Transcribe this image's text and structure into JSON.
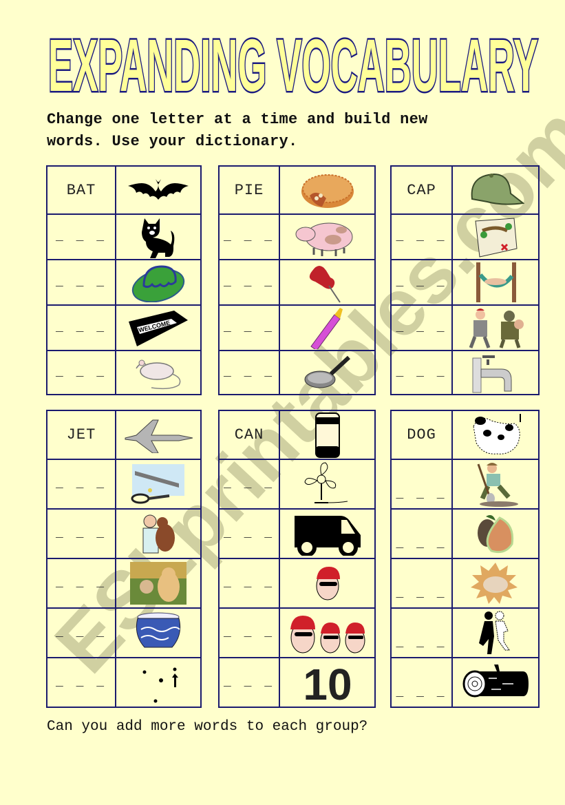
{
  "title": "EXPANDING VOCABULARY",
  "instructions": [
    "Change one letter at a time and build new",
    "words. Use your dictionary."
  ],
  "footer": "Can you add more words to each group?",
  "watermark": "ESLprintables.com",
  "blank": "_ _ _",
  "colors": {
    "background": "#ffffcc",
    "grid": "#1a1a6e",
    "title_fill": "#ffff99",
    "title_stroke": "#1a1a80"
  },
  "groups": [
    {
      "word": "BAT",
      "pictures": [
        "bat-icon",
        "cat-icon",
        "hat-icon",
        "welcome-mat-icon",
        "rat-icon"
      ]
    },
    {
      "word": "PIE",
      "pictures": [
        "pie-icon",
        "pig-icon",
        "pin-icon",
        "pen-icon",
        "pan-icon"
      ]
    },
    {
      "word": "CAP",
      "pictures": [
        "cap-icon",
        "map-icon",
        "nap-icon",
        "rap-icon",
        "tap-icon"
      ]
    },
    {
      "word": "JET",
      "pictures": [
        "jet-icon",
        "net-icon",
        "vet-icon",
        "pet-icon",
        "pot-icon",
        "dot-icon"
      ]
    },
    {
      "word": "CAN",
      "pictures": [
        "can-icon",
        "fan-icon",
        "van-icon",
        "man-icon",
        "men-icon",
        "ten-icon"
      ]
    },
    {
      "word": "DOG",
      "pictures": [
        "dog-icon",
        "digger-icon",
        "fig-icon",
        "fog-icon",
        "jog-icon",
        "log-icon"
      ]
    }
  ]
}
